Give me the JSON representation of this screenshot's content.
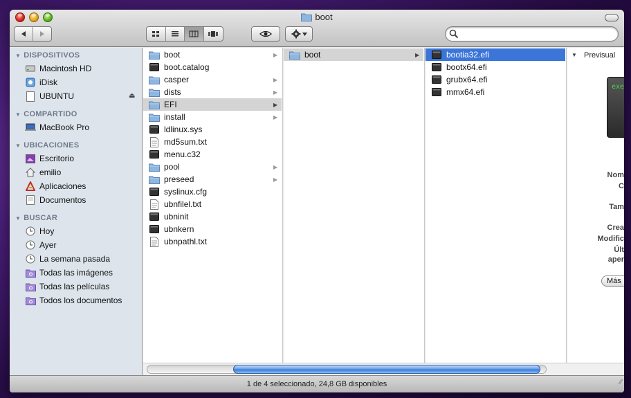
{
  "window": {
    "title": "boot"
  },
  "toolbar": {
    "nav": [
      "back-arrow-icon",
      "forward-arrow-icon"
    ],
    "view_modes": [
      "icon-view-icon",
      "list-view-icon",
      "column-view-icon",
      "coverflow-view-icon"
    ],
    "active_view": "column",
    "quicklook": "eye-icon",
    "action": "gear-icon",
    "search_placeholder": ""
  },
  "sidebar": {
    "sections": [
      {
        "title": "DISPOSITIVOS",
        "items": [
          {
            "label": "Macintosh HD",
            "icon": "hard-drive-icon"
          },
          {
            "label": "iDisk",
            "icon": "idisk-icon"
          },
          {
            "label": "UBUNTU",
            "icon": "volume-icon",
            "eject": true
          }
        ]
      },
      {
        "title": "COMPARTIDO",
        "items": [
          {
            "label": "MacBook Pro",
            "icon": "laptop-icon"
          }
        ]
      },
      {
        "title": "UBICACIONES",
        "items": [
          {
            "label": "Escritorio",
            "icon": "desktop-icon"
          },
          {
            "label": "emilio",
            "icon": "home-icon"
          },
          {
            "label": "Aplicaciones",
            "icon": "applications-icon"
          },
          {
            "label": "Documentos",
            "icon": "documents-icon"
          }
        ]
      },
      {
        "title": "BUSCAR",
        "items": [
          {
            "label": "Hoy",
            "icon": "clock-icon"
          },
          {
            "label": "Ayer",
            "icon": "clock-icon"
          },
          {
            "label": "La semana pasada",
            "icon": "clock-icon"
          },
          {
            "label": "Todas las imágenes",
            "icon": "smart-folder-icon"
          },
          {
            "label": "Todas las películas",
            "icon": "smart-folder-icon"
          },
          {
            "label": "Todos los documentos",
            "icon": "smart-folder-icon"
          }
        ]
      }
    ]
  },
  "columns": [
    {
      "items": [
        {
          "label": "boot",
          "kind": "folder",
          "arrow": true
        },
        {
          "label": "boot.catalog",
          "kind": "file"
        },
        {
          "label": "casper",
          "kind": "folder",
          "arrow": true
        },
        {
          "label": "dists",
          "kind": "folder",
          "arrow": true
        },
        {
          "label": "EFI",
          "kind": "folder",
          "arrow": true,
          "selected": "gray"
        },
        {
          "label": "install",
          "kind": "folder",
          "arrow": true
        },
        {
          "label": "ldlinux.sys",
          "kind": "file"
        },
        {
          "label": "md5sum.txt",
          "kind": "text"
        },
        {
          "label": "menu.c32",
          "kind": "file"
        },
        {
          "label": "pool",
          "kind": "folder",
          "arrow": true
        },
        {
          "label": "preseed",
          "kind": "folder",
          "arrow": true
        },
        {
          "label": "syslinux.cfg",
          "kind": "file"
        },
        {
          "label": "ubnfilel.txt",
          "kind": "text"
        },
        {
          "label": "ubninit",
          "kind": "file"
        },
        {
          "label": "ubnkern",
          "kind": "file"
        },
        {
          "label": "ubnpathl.txt",
          "kind": "text"
        }
      ]
    },
    {
      "items": [
        {
          "label": "boot",
          "kind": "folder",
          "arrow": true,
          "selected": "gray"
        }
      ]
    },
    {
      "items": [
        {
          "label": "bootia32.efi",
          "kind": "file",
          "selected": "blue"
        },
        {
          "label": "bootx64.efi",
          "kind": "file"
        },
        {
          "label": "grubx64.efi",
          "kind": "file"
        },
        {
          "label": "mmx64.efi",
          "kind": "file"
        }
      ]
    }
  ],
  "preview": {
    "heading": "Previsual",
    "thumb_text": "exe",
    "labels": [
      "Nom",
      "C",
      "Tam",
      "Crea",
      "Modific",
      "Últ",
      "aper"
    ],
    "more_button": "Más"
  },
  "status": {
    "text": "1 de 4 seleccionado, 24,8 GB disponibles"
  },
  "colors": {
    "selection_blue": "#3b75d8",
    "sidebar_bg": "#dde4ec",
    "folder_blue": "#8fb6de"
  }
}
